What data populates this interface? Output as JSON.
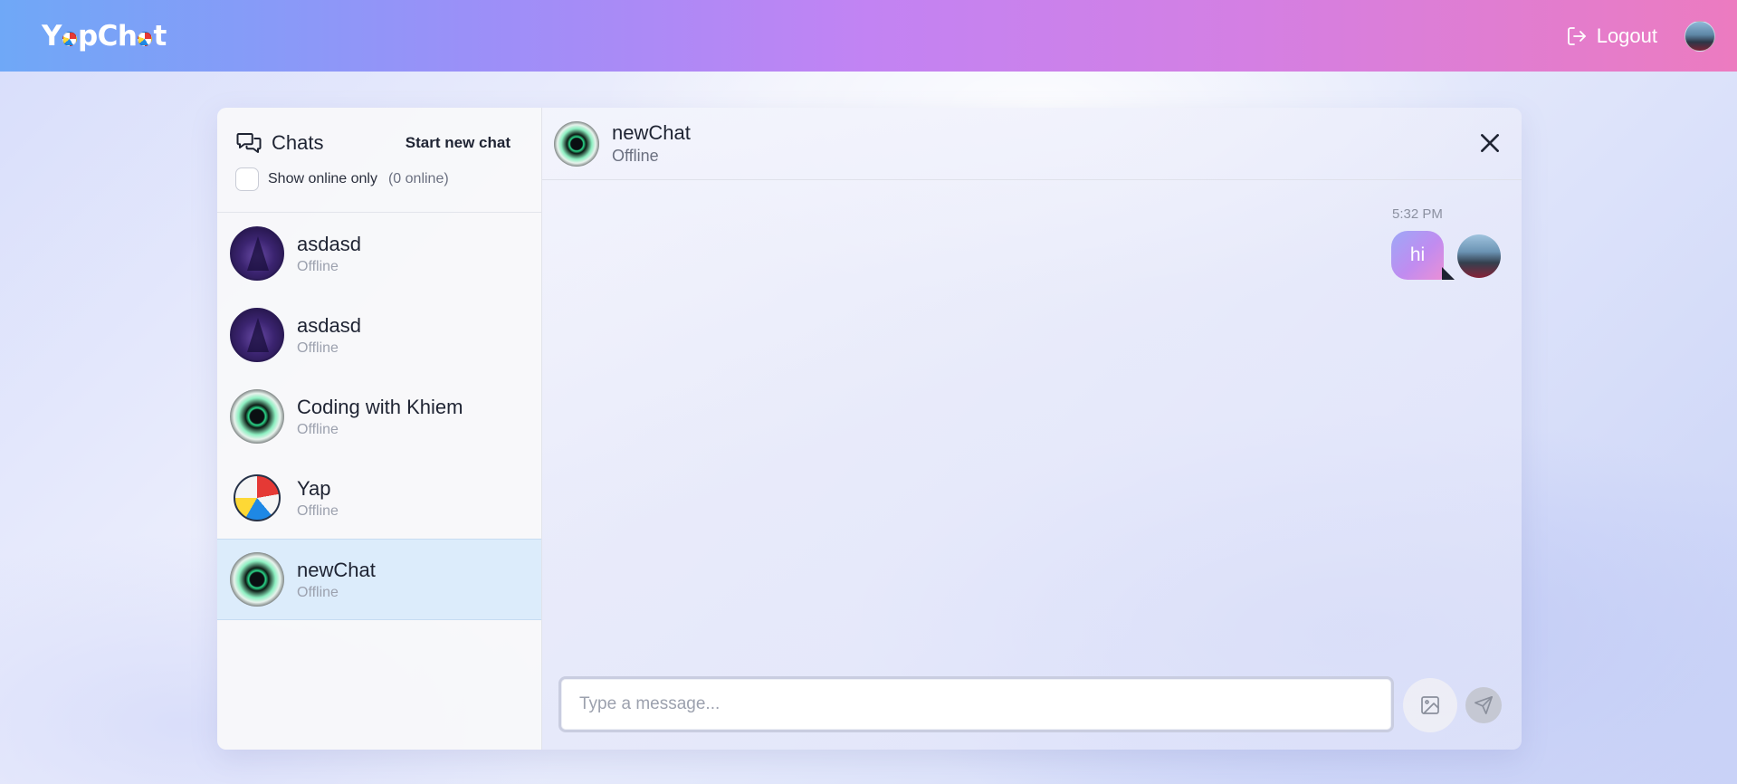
{
  "app": {
    "name": "YapChat"
  },
  "header": {
    "logout_label": "Logout"
  },
  "sidebar": {
    "title": "Chats",
    "new_chat_label": "Start new chat",
    "filter_label": "Show online only",
    "online_count": "(0 online)",
    "contacts": [
      {
        "name": "asdasd",
        "status": "Offline",
        "avatar": "witch-avatar"
      },
      {
        "name": "asdasd",
        "status": "Offline",
        "avatar": "witch-avatar"
      },
      {
        "name": "Coding with Khiem",
        "status": "Offline",
        "avatar": "neon-avatar"
      },
      {
        "name": "Yap",
        "status": "Offline",
        "avatar": "beach-ball-avatar"
      },
      {
        "name": "newChat",
        "status": "Offline",
        "avatar": "neon-avatar",
        "selected": true
      }
    ]
  },
  "chat": {
    "name": "newChat",
    "status": "Offline",
    "messages": [
      {
        "time": "5:32 PM",
        "text": "hi",
        "from": "me"
      }
    ],
    "composer": {
      "placeholder": "Type a message..."
    }
  },
  "colors": {
    "header_gradient": [
      "#6fa8f7",
      "#c283f3",
      "#ec7bc0"
    ],
    "selected_row": "#dcecfb",
    "bubble_gradient": [
      "#9da8f7",
      "#ea8fd6"
    ]
  }
}
